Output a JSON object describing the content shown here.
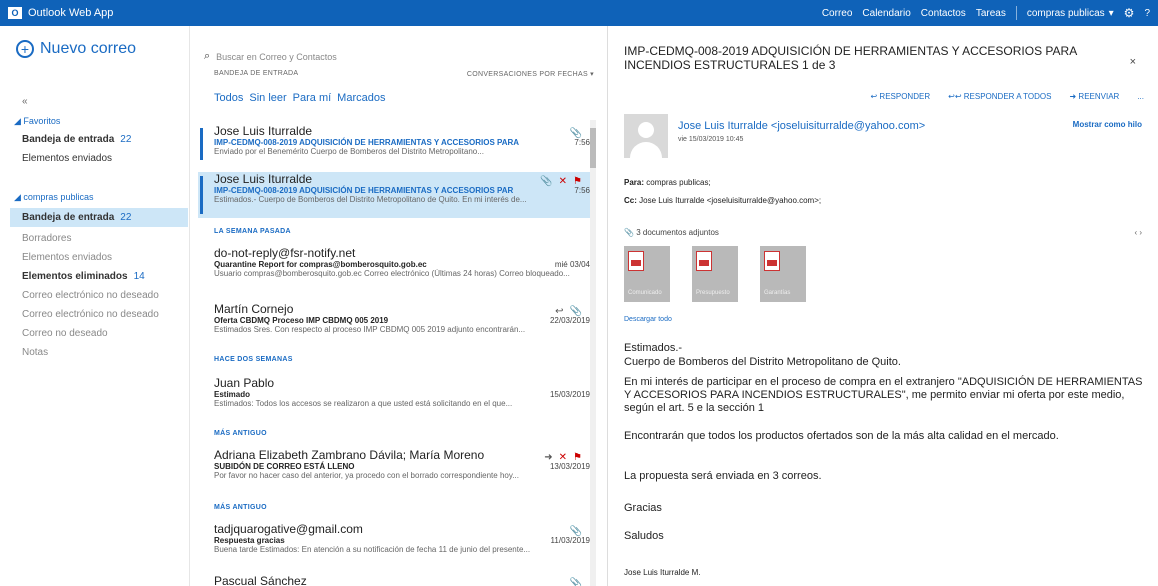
{
  "app": {
    "title": "Outlook Web App"
  },
  "topnav": {
    "items": [
      "Correo",
      "Calendario",
      "Contactos",
      "Tareas"
    ],
    "user": "compras publicas"
  },
  "leftnav": {
    "new_mail": "Nuevo correo",
    "favorites_title": "Favoritos",
    "favorites": [
      {
        "label": "Bandeja de entrada",
        "count": "22"
      },
      {
        "label": "Elementos enviados",
        "count": ""
      }
    ],
    "account_title": "compras publicas",
    "folders": [
      {
        "label": "Bandeja de entrada",
        "count": "22"
      },
      {
        "label": "Borradores",
        "count": ""
      },
      {
        "label": "Elementos enviados",
        "count": ""
      },
      {
        "label": "Elementos eliminados",
        "count": "14"
      },
      {
        "label": "Correo electrónico no deseado",
        "count": ""
      },
      {
        "label": "Correo electrónico no deseado",
        "count": ""
      },
      {
        "label": "Correo no deseado",
        "count": ""
      },
      {
        "label": "Notas",
        "count": ""
      }
    ]
  },
  "list": {
    "search_placeholder": "Buscar en Correo y Contactos",
    "header_left": "BANDEJA DE ENTRADA",
    "header_right": "CONVERSACIONES POR FECHAS",
    "filters": [
      "Todos",
      "Sin leer",
      "Para mí",
      "Marcados"
    ],
    "sections": [
      "LA SEMANA PASADA",
      "HACE DOS SEMANAS",
      "MÁS ANTIGUO",
      "MÁS ANTIGUO"
    ],
    "messages": [
      {
        "from": "Jose Luis Iturralde",
        "subject": "IMP-CEDMQ-008-2019 ADQUISICIÓN DE HERRAMIENTAS Y ACCESORIOS PARA",
        "date": "7:56",
        "preview": "Enviado por el Benemérito Cuerpo de Bomberos del Distrito Metropolitano..."
      },
      {
        "from": "Jose Luis Iturralde",
        "subject": "IMP-CEDMQ-008-2019 ADQUISICIÓN DE HERRAMIENTAS Y ACCESORIOS PAR",
        "date": "7:56",
        "preview": "Estimados.- Cuerpo de Bomberos del Distrito Metropolitano de Quito. En mi interés de..."
      },
      {
        "from": "do-not-reply@fsr-notify.net",
        "subject": "Quarantine Report for compras@bomberosquito.gob.ec",
        "date": "mié 03/04",
        "preview": "Usuario compras@bomberosquito.gob.ec Correo electrónico (Últimas 24 horas) Correo bloqueado..."
      },
      {
        "from": "Martín Cornejo",
        "subject": "Oferta CBDMQ    Proceso IMP CBDMQ 005 2019",
        "date": "22/03/2019",
        "preview": "Estimados Sres. Con respecto al proceso IMP CBDMQ 005 2019 adjunto encontrarán..."
      },
      {
        "from": "Juan Pablo",
        "subject": "Estimado",
        "date": "15/03/2019",
        "preview": "Estimados: Todos los accesos se realizaron a que usted está solicitando en el que..."
      },
      {
        "from": "Adriana Elizabeth Zambrano Dávila; María Moreno",
        "subject": "SUBIDÓN DE CORREO ESTÁ LLENO",
        "date": "13/03/2019",
        "preview": "Por favor no hacer caso del anterior, ya procedo con el borrado correspondiente hoy..."
      },
      {
        "from": "tadjquarogative@gmail.com",
        "subject": "Respuesta gracias",
        "date": "11/03/2019",
        "preview": "Buena tarde Estimados: En atención a su notificación de fecha 11 de junio del presente..."
      },
      {
        "from": "Pascual Sánchez",
        "subject": "",
        "date": "",
        "preview": ""
      }
    ]
  },
  "reading": {
    "subject": "IMP-CEDMQ-008-2019 ADQUISICIÓN DE HERRAMIENTAS Y ACCESORIOS PARA INCENDIOS ESTRUCTURALES 1 de 3",
    "actions": [
      "RESPONDER",
      "RESPONDER A TODOS",
      "REENVIAR",
      "..."
    ],
    "sender": "Jose Luis Iturralde <joseluisiturralde@yahoo.com>",
    "sent": "vie 15/03/2019 10:45",
    "show_details": "Mostrar como hilo",
    "para_label": "Para:",
    "para_value": "compras publicas;",
    "cc_label": "Cc:",
    "cc_value": "Jose Luis Iturralde <joseluisiturralde@yahoo.com>;",
    "attachments_label": "3 documentos adjuntos",
    "attachment_captions": [
      "Comunicado",
      "Presupuesto",
      "Garantías"
    ],
    "download_all": "Descargar todo",
    "body": [
      "Estimados.-",
      "Cuerpo de Bomberos del Distrito Metropolitano de Quito.",
      "En mi interés de participar en el proceso de compra en el extranjero \"ADQUISICIÓN DE HERRAMIENTAS Y ACCESORIOS PARA INCENDIOS ESTRUCTURALES\", me permito enviar mi oferta por este medio, según el art. 5 e la sección 1",
      "Encontrarán que todos los productos ofertados son de la más alta calidad en el mercado.",
      "La propuesta será enviada en 3 correos.",
      "Gracias",
      "Saludos",
      "Jose Luis Iturralde M."
    ]
  },
  "colors": {
    "brand": "#0f62b8",
    "link": "#1a6bc3",
    "selected": "#cde6f7",
    "delete": "#cc0000"
  }
}
